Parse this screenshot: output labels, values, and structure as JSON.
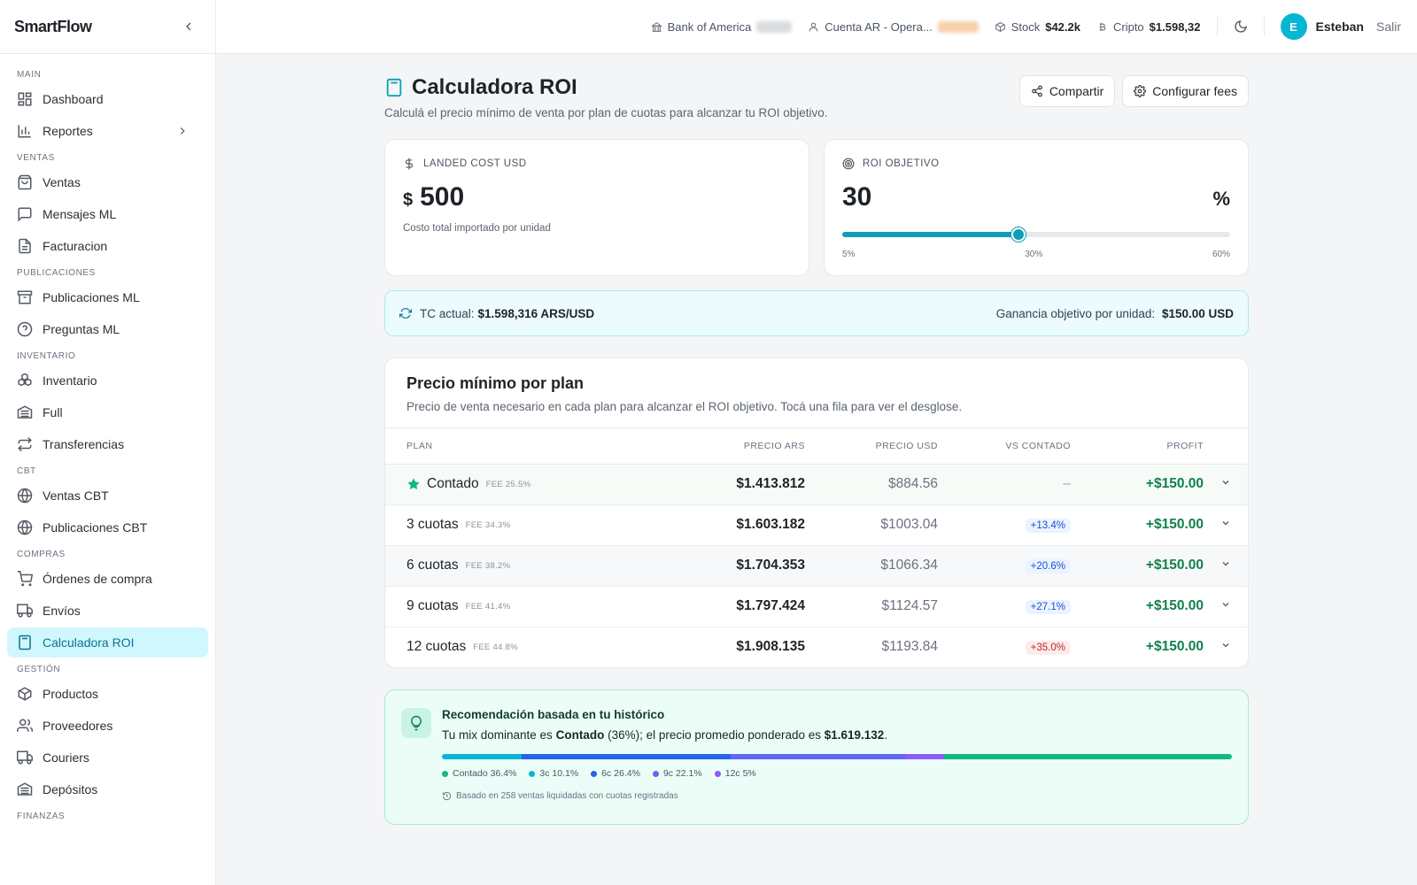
{
  "brand": "SmartFlow",
  "sidebar": {
    "sections": {
      "main": "MAIN",
      "ventas": "VENTAS",
      "publicaciones": "PUBLICACIONES",
      "inventario": "INVENTARIO",
      "cbt": "CBT",
      "compras": "COMPRAS",
      "gestion": "GESTIÓN",
      "finanzas": "FINANZAS"
    },
    "items": {
      "dashboard": "Dashboard",
      "reportes": "Reportes",
      "ventas": "Ventas",
      "mensajes": "Mensajes ML",
      "facturacion": "Facturacion",
      "publicaciones": "Publicaciones ML",
      "preguntas": "Preguntas ML",
      "inventario": "Inventario",
      "full": "Full",
      "transferencias": "Transferencias",
      "ventas_cbt": "Ventas CBT",
      "publicaciones_cbt": "Publicaciones CBT",
      "ordenes": "Órdenes de compra",
      "envios": "Envíos",
      "calculadora": "Calculadora ROI",
      "productos": "Productos",
      "proveedores": "Proveedores",
      "couriers": "Couriers",
      "depositos": "Depósitos"
    }
  },
  "topbar": {
    "bank": "Bank of America",
    "account": "Cuenta AR - Opera...",
    "stock_label": "Stock",
    "stock_value": "$42.2k",
    "crypto_label": "Cripto",
    "crypto_value": "$1.598,32",
    "avatar_initial": "E",
    "username": "Esteban",
    "logout": "Salir"
  },
  "page": {
    "title": "Calculadora ROI",
    "subtitle": "Calculá el precio mínimo de venta por plan de cuotas para alcanzar tu ROI objetivo.",
    "share_button": "Compartir",
    "fees_button": "Configurar fees"
  },
  "landed_cost": {
    "label": "LANDED COST USD",
    "currency": "$",
    "value": "500",
    "note": "Costo total importado por unidad"
  },
  "roi": {
    "label": "ROI OBJETIVO",
    "value": "30",
    "unit": "%",
    "min_label": "5%",
    "mid_label": "30%",
    "max_label": "60%",
    "slider_fraction": 0.4545
  },
  "tc": {
    "label": "TC actual:",
    "value": "$1.598,316 ARS/USD",
    "goal_label": "Ganancia objetivo por unidad:",
    "goal_value": "$150.00 USD"
  },
  "plans": {
    "title": "Precio mínimo por plan",
    "subtitle": "Precio de venta necesario en cada plan para alcanzar el ROI objetivo. Tocá una fila para ver el desglose.",
    "headers": {
      "plan": "PLAN",
      "ars": "PRECIO ARS",
      "usd": "PRECIO USD",
      "vs": "VS CONTADO",
      "profit": "PROFIT"
    },
    "rows": [
      {
        "name": "Contado",
        "fee": "FEE 25.5%",
        "ars": "$1.413.812",
        "usd": "$884.56",
        "vs": "–",
        "profit": "+$150.00"
      },
      {
        "name": "3 cuotas",
        "fee": "FEE 34.3%",
        "ars": "$1.603.182",
        "usd": "$1003.04",
        "vs": "+13.4%",
        "profit": "+$150.00"
      },
      {
        "name": "6 cuotas",
        "fee": "FEE 38.2%",
        "ars": "$1.704.353",
        "usd": "$1066.34",
        "vs": "+20.6%",
        "profit": "+$150.00"
      },
      {
        "name": "9 cuotas",
        "fee": "FEE 41.4%",
        "ars": "$1.797.424",
        "usd": "$1124.57",
        "vs": "+27.1%",
        "profit": "+$150.00"
      },
      {
        "name": "12 cuotas",
        "fee": "FEE 44.8%",
        "ars": "$1.908.135",
        "usd": "$1193.84",
        "vs": "+35.0%",
        "profit": "+$150.00"
      }
    ]
  },
  "reco": {
    "title": "Recomendación basada en tu histórico",
    "text_1": "Tu mix dominante es",
    "dominant": "Contado",
    "text_2": "(36%); el precio promedio ponderado es",
    "weighted": "$1.619.132",
    "text_3": ".",
    "mix": [
      {
        "label": "3c 10.1%",
        "value": 10.1,
        "color": "#06b6d4"
      },
      {
        "label": "6c 26.4%",
        "value": 26.4,
        "color": "#2563eb"
      },
      {
        "label": "9c 22.1%",
        "value": 22.1,
        "color": "#6366f1"
      },
      {
        "label": "12c 5%",
        "value": 5,
        "color": "#8b5cf6"
      },
      {
        "label": "Contado 36.4%",
        "value": 36.4,
        "color": "#10b981"
      }
    ],
    "legend": [
      {
        "label": "Contado 36.4%",
        "color": "#10b981"
      },
      {
        "label": "3c 10.1%",
        "color": "#06b6d4"
      },
      {
        "label": "6c 26.4%",
        "color": "#2563eb"
      },
      {
        "label": "9c 22.1%",
        "color": "#6366f1"
      },
      {
        "label": "12c 5%",
        "color": "#8b5cf6"
      }
    ],
    "footnote": "Basado en 258 ventas liquidadas con cuotas registradas"
  },
  "colors": {
    "accent": "#0e9fb8",
    "success": "#10b981",
    "danger": "#c02626"
  }
}
